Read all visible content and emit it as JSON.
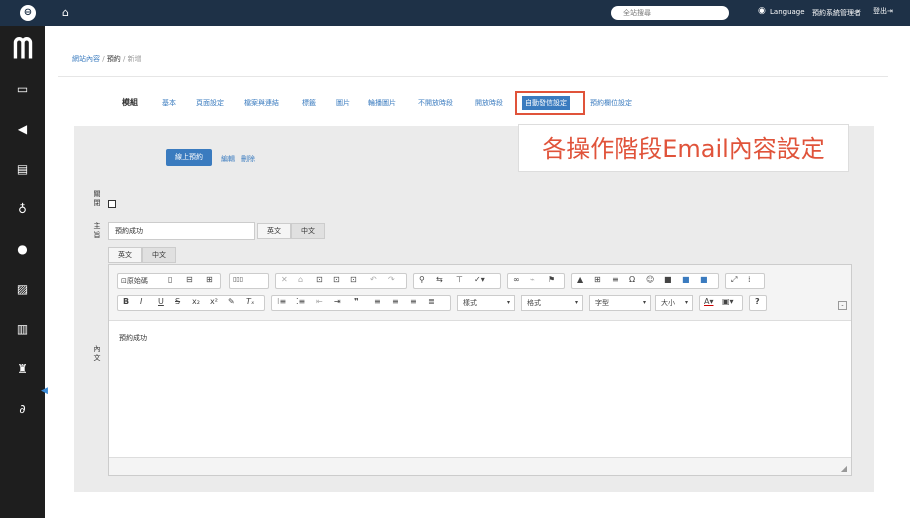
{
  "topbar": {
    "search_placeholder": "全站搜尋",
    "language_label": "Language",
    "admin_label": "預約系統管理者",
    "logout_label": "登出"
  },
  "breadcrumb": {
    "root": "網站內容",
    "sep1": " / ",
    "section": "預約",
    "sep2": " / ",
    "current": "新增"
  },
  "tabs": {
    "module": "模組",
    "items": [
      "基本",
      "頁面設定",
      "檔案與連結",
      "標籤",
      "圖片",
      "輪播圖片",
      "不開放時段",
      "開放時段",
      "自動發信設定",
      "預約欄位設定"
    ]
  },
  "callout": "各操作階段Email內容設定",
  "actions": {
    "online_booking": "線上預約",
    "edit": "編輯",
    "delete": "刪除"
  },
  "form": {
    "disable_label": "關閉",
    "subject_label": "主旨",
    "subject_value": "預約成功",
    "lang_en": "英文",
    "lang_zh": "中文",
    "content_label": "內文",
    "content_value": "預約成功"
  },
  "editor": {
    "source_label": "原始碼",
    "style_drop": "樣式",
    "format_drop": "格式",
    "font_drop": "字型",
    "size_drop": "大小",
    "help": "?"
  },
  "icons": {
    "logo": "logo-icon",
    "home": "home-icon",
    "globe": "globe-icon",
    "logout": "logout-icon"
  },
  "colors": {
    "topbar": "#1e3147",
    "sidebar": "#1e1e1e",
    "accent": "#3a7bbf",
    "highlight": "#e0533a"
  }
}
